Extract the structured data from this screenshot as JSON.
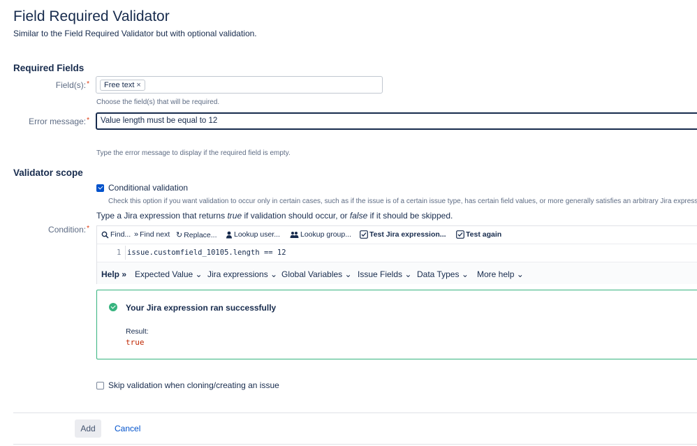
{
  "page": {
    "title": "Field Required Validator",
    "subtitle": "Similar to the Field Required Validator but with optional validation."
  },
  "required_fields": {
    "heading": "Required Fields",
    "fields_label": "Field(s):",
    "selected_tag": "Free text",
    "tag_remove_glyph": "×",
    "fields_help": "Choose the field(s) that will be required.",
    "error_label": "Error message:",
    "error_value": "Value length must be equal to 12",
    "error_help": "Type the error message to display if the required field is empty."
  },
  "validator_scope": {
    "heading": "Validator scope",
    "conditional_label": "Conditional validation",
    "conditional_checked": true,
    "conditional_help": "Check this option if you want validation to occur only in certain cases, such as if the issue is of a certain issue type, has certain field values, or more generally satisfies an arbitrary Jira expression.",
    "prompt_before": "Type a Jira expression that returns ",
    "prompt_true": "true",
    "prompt_middle": " if validation should occur, or ",
    "prompt_false": "false",
    "prompt_after": " if it should be skipped."
  },
  "condition": {
    "label": "Condition:",
    "toolbar": {
      "find": "Find...",
      "find_next": "Find next",
      "replace": "Replace...",
      "lookup_user": "Lookup user...",
      "lookup_group": "Lookup group...",
      "test_expression": "Test Jira expression...",
      "test_again": "Test again"
    },
    "code": {
      "line_number": "1",
      "text": "issue.customfield_10105.length == 12"
    },
    "help_bar": {
      "help": "Help",
      "expected_value": "Expected Value",
      "jira_expressions": "Jira expressions",
      "global_variables": "Global Variables",
      "issue_fields": "Issue Fields",
      "data_types": "Data Types",
      "more_help": "More help"
    }
  },
  "result": {
    "title": "Your Jira expression ran successfully",
    "label": "Result:",
    "value": "true",
    "status_color": "#36b37e"
  },
  "skip_option": {
    "label": "Skip validation when cloning/creating an issue",
    "checked": false
  },
  "actions": {
    "add": "Add",
    "cancel": "Cancel"
  },
  "colors": {
    "accent": "#0052cc",
    "required": "#de350b",
    "success": "#36b37e",
    "result_value": "#bf2600"
  },
  "icons": {
    "find": "search-icon",
    "find_next": "double-chevron-right-icon",
    "replace": "replace-icon",
    "lookup_user": "user-icon",
    "lookup_group": "group-icon",
    "test": "checklist-icon",
    "success": "check-circle-icon",
    "dropdown": "chevron-down-icon"
  }
}
